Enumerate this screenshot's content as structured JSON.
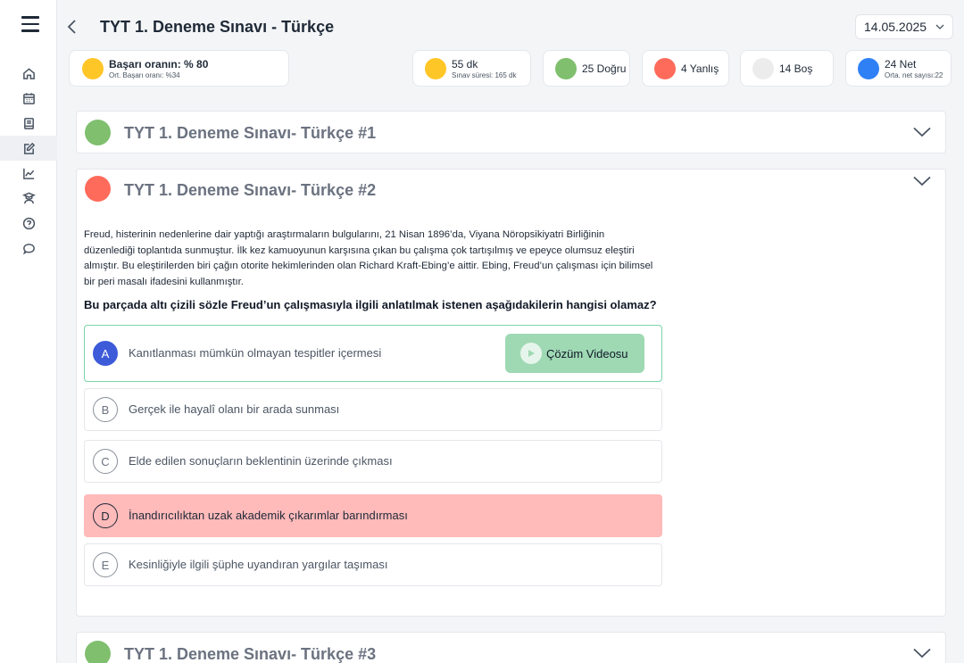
{
  "header": {
    "title": "TYT 1. Deneme Sınavı - Türkçe",
    "date": "14.05.2025"
  },
  "stats": {
    "success": {
      "main": "Başarı oranın: % 80",
      "sub": "Ort. Başarı oranı: %34",
      "color": "#ffc628"
    },
    "duration": {
      "main": "55 dk",
      "sub": "Sınav süresi: 165 dk",
      "color": "#ffc628"
    },
    "correct": {
      "main": "25 Doğru",
      "color": "#7fbf6e"
    },
    "wrong": {
      "main": "4 Yanlış",
      "color": "#ff6b5b"
    },
    "empty": {
      "main": "14 Boş",
      "color": "#ececec"
    },
    "net": {
      "main": "24 Net",
      "sub": "Orta. net sayısı:22",
      "color": "#2f80f5"
    }
  },
  "panels": [
    {
      "title": "TYT 1. Deneme Sınavı- Türkçe #1",
      "status_color": "#7fbf6e"
    },
    {
      "title": "TYT 1. Deneme Sınavı- Türkçe #2",
      "status_color": "#ff6b5b"
    },
    {
      "title": "TYT 1. Deneme Sınavı- Türkçe #3",
      "status_color": "#7fbf6e"
    }
  ],
  "question": {
    "passage": "Freud, histerinin nedenlerine dair yaptığı araştırmaların bulgularını, 21 Nisan 1896’da, Viyana Nöropsikiyatri Birliğinin düzenlediği toplantıda sunmuştur. İlk kez kamuoyunun karşısına çıkan bu çalışma çok tartışılmış ve epeyce olumsuz eleştiri almıştır. Bu eleştirilerden biri çağın otorite hekimlerinden olan Richard Kraft-Ebing’e aittir. Ebing, Freud’un çalışması için bilimsel bir peri masalı ifadesini kullanmıştır.",
    "stem": "Bu parçada altı çizili sözle Freud’un çalışmasıyla ilgili anlatılmak istenen aşağıdakilerin hangisi olamaz?",
    "video_label": "Çözüm Videosu",
    "options": [
      {
        "letter": "A",
        "text": "Kanıtlanması mümkün olmayan tespitler içermesi"
      },
      {
        "letter": "B",
        "text": "Gerçek ile hayalî olanı bir arada sunması"
      },
      {
        "letter": "C",
        "text": "Elde edilen sonuçların beklentinin üzerinde çıkması"
      },
      {
        "letter": "D",
        "text": "İnandırıcılıktan uzak akademik çıkarımlar barındırması"
      },
      {
        "letter": "E",
        "text": "Kesinliğiyle ilgili şüphe uyandıran yargılar taşıması"
      }
    ]
  },
  "sidebar": {
    "icons": [
      "home-icon",
      "calendar-icon",
      "book-icon",
      "edit-icon",
      "chart-icon",
      "teacher-icon",
      "help-icon",
      "chat-icon"
    ]
  }
}
